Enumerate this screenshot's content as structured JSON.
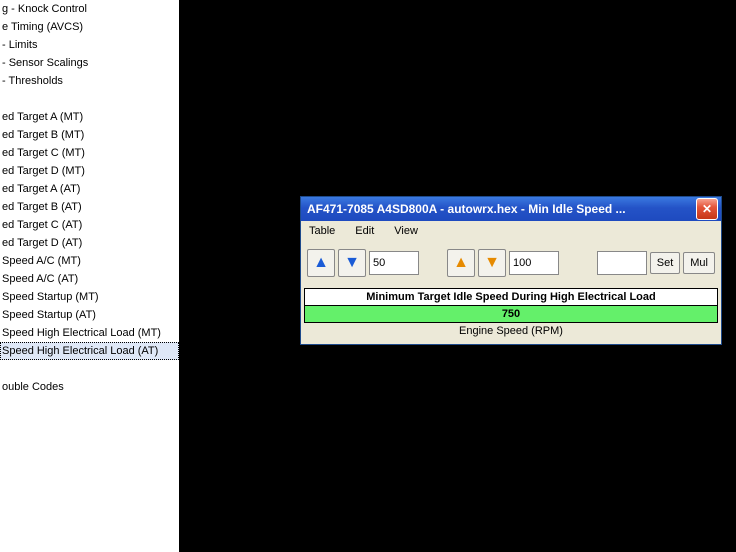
{
  "sidebar": {
    "items": [
      {
        "label": "g - Knock Control"
      },
      {
        "label": "e Timing (AVCS)"
      },
      {
        "label": " - Limits"
      },
      {
        "label": " - Sensor Scalings"
      },
      {
        "label": " - Thresholds"
      },
      {
        "label": ""
      },
      {
        "label": "ed Target A (MT)"
      },
      {
        "label": "ed Target B (MT)"
      },
      {
        "label": "ed Target C (MT)"
      },
      {
        "label": "ed Target D (MT)"
      },
      {
        "label": "ed Target A (AT)"
      },
      {
        "label": "ed Target B (AT)"
      },
      {
        "label": "ed Target C (AT)"
      },
      {
        "label": "ed Target D (AT)"
      },
      {
        "label": "Speed A/C (MT)"
      },
      {
        "label": "Speed A/C (AT)"
      },
      {
        "label": "Speed Startup (MT)"
      },
      {
        "label": "Speed Startup (AT)"
      },
      {
        "label": "Speed High Electrical Load (MT)"
      },
      {
        "label": "Speed High Electrical Load (AT)",
        "selected": true
      },
      {
        "label": ""
      },
      {
        "label": "ouble Codes"
      }
    ]
  },
  "dialog": {
    "title": "AF471-7085 A4SD800A - autowrx.hex - Min Idle Speed ...",
    "menu": {
      "table": "Table",
      "edit": "Edit",
      "view": "View"
    },
    "toolbar": {
      "coarse_value": "50",
      "fine_value": "100",
      "custom_value": "",
      "set_label": "Set",
      "mul_label": "Mul"
    },
    "table": {
      "header": "Minimum Target Idle Speed During High Electrical Load",
      "value": "750",
      "axis": "Engine Speed (RPM)"
    }
  }
}
